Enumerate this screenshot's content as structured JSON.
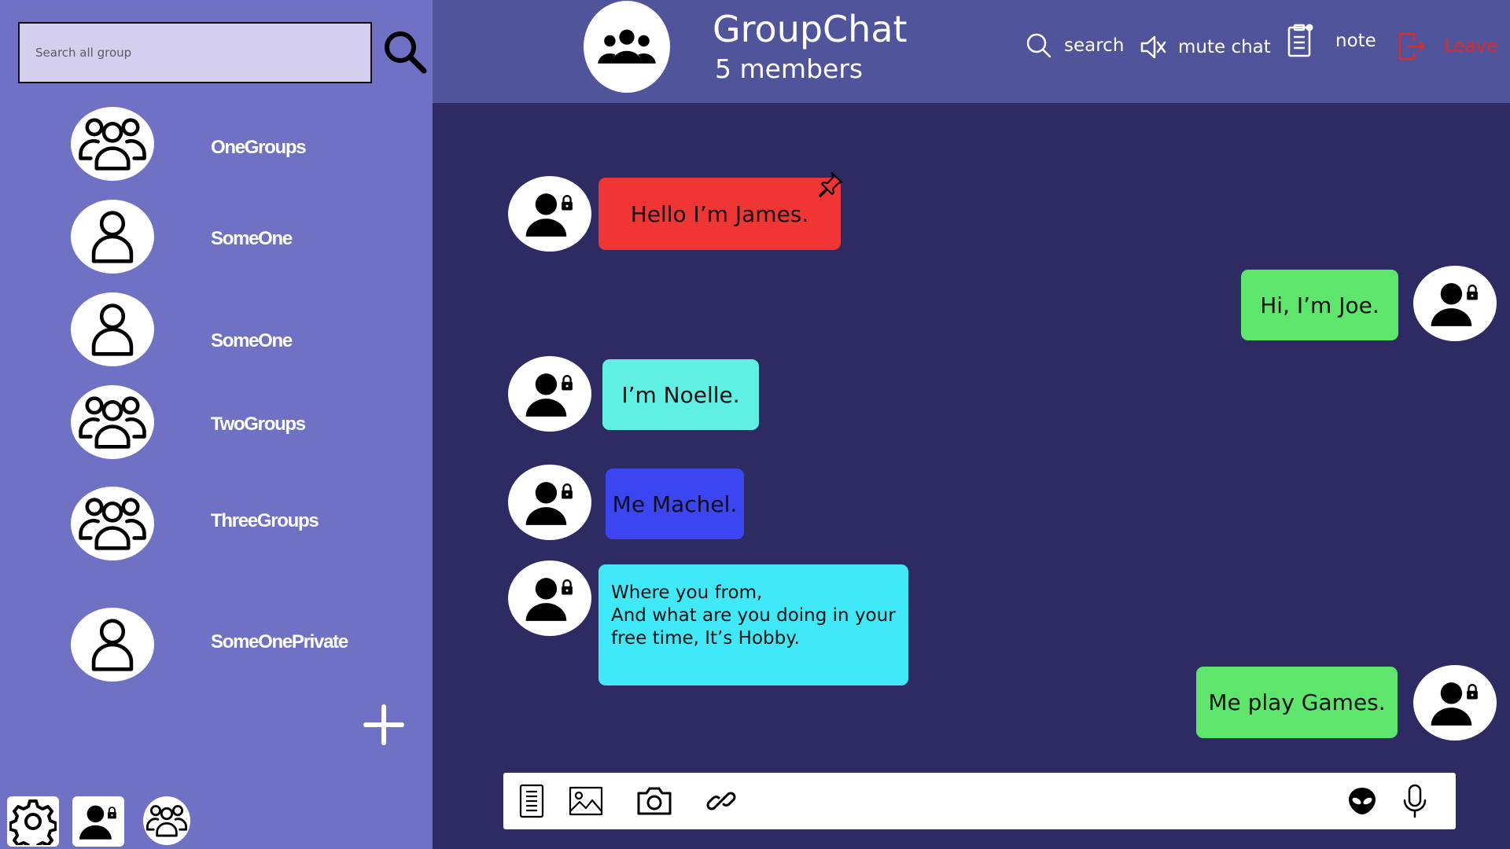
{
  "sidebar": {
    "search_placeholder": "Search all group",
    "groups": [
      {
        "name": "OneGroups",
        "icon": "group-icon"
      },
      {
        "name": "SomeOne",
        "icon": "user-icon"
      },
      {
        "name": "SomeOne",
        "icon": "user-icon"
      },
      {
        "name": "TwoGroups",
        "icon": "group-icon"
      },
      {
        "name": "ThreeGroups",
        "icon": "group-icon"
      },
      {
        "name": "SomeOnePrivate",
        "icon": "user-icon"
      }
    ],
    "bottom_icons": [
      "gear-icon",
      "private-user-icon",
      "group-icon"
    ]
  },
  "header": {
    "title": "GroupChat",
    "subtitle": "5 members",
    "actions": [
      {
        "label": "search",
        "icon": "search-icon"
      },
      {
        "label": "mute chat",
        "icon": "speaker-muted-icon"
      },
      {
        "label": "note",
        "icon": "clipboard-icon"
      },
      {
        "label": "Leave",
        "icon": "exit-icon"
      }
    ]
  },
  "messages": [
    {
      "text": "Hello I’m James.",
      "color": "#f03535",
      "side": "left",
      "pinned": true
    },
    {
      "text": "Hi, I’m Joe.",
      "color": "#5de56c",
      "side": "right"
    },
    {
      "text": "I’m Noelle.",
      "color": "#5ff0e3",
      "side": "left"
    },
    {
      "text": "Me Machel.",
      "color": "#3b45f2",
      "side": "left"
    },
    {
      "lines": [
        "Where you from,",
        "And what are you doing in your",
        "free time, It’s Hobby."
      ],
      "color": "#3fe9f7",
      "side": "left"
    },
    {
      "text": "Me play Games.",
      "color": "#5de56c",
      "side": "right"
    }
  ],
  "composer": {
    "icons": [
      "document-icon",
      "image-icon",
      "camera-icon",
      "link-icon",
      "alien-emoji-icon",
      "microphone-icon"
    ]
  },
  "colors": {
    "sidebar_bg": "#6e71c4",
    "header_bg": "#50549a",
    "chat_bg": "#2e2a62",
    "leave_red": "#e02a2a"
  }
}
